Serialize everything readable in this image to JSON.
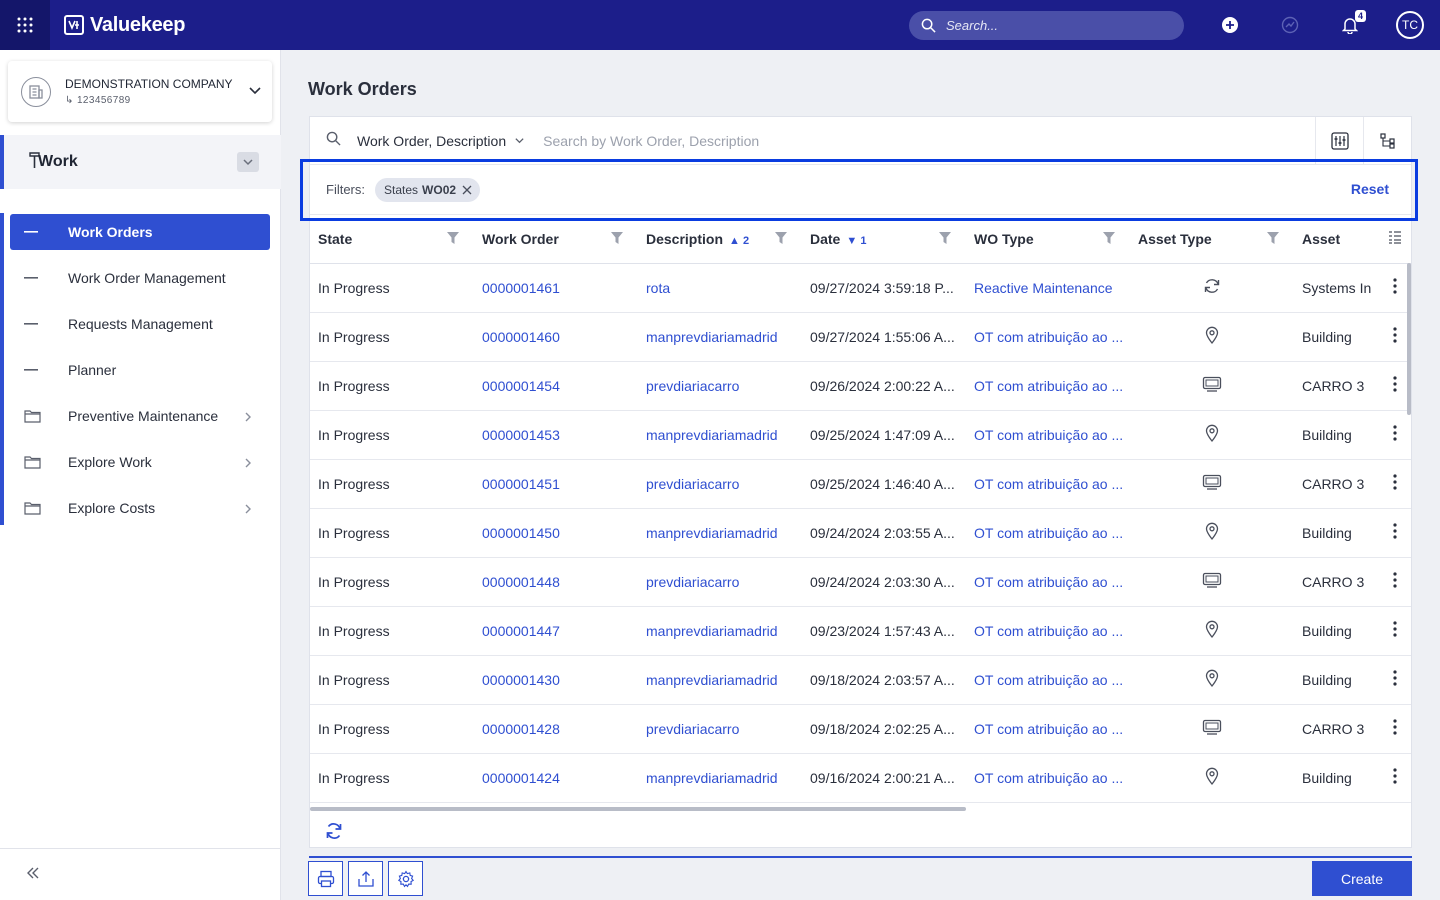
{
  "app": {
    "brand": "Valuekeep",
    "search_placeholder": "Search...",
    "notifications_count": "4",
    "user_initials": "TC"
  },
  "sidebar": {
    "company_name": "DEMONSTRATION COMPANY",
    "company_id": "123456789",
    "module": "Work",
    "items": [
      {
        "label": "Work Orders",
        "icon": "dash-icon",
        "active": true
      },
      {
        "label": "Work Order Management",
        "icon": "dash-icon"
      },
      {
        "label": "Requests Management",
        "icon": "dash-icon"
      },
      {
        "label": "Planner",
        "icon": "dash-icon"
      },
      {
        "label": "Preventive Maintenance",
        "icon": "folder-icon",
        "expandable": true
      },
      {
        "label": "Explore Work",
        "icon": "folder-icon",
        "expandable": true
      },
      {
        "label": "Explore Costs",
        "icon": "folder-icon",
        "expandable": true
      }
    ]
  },
  "main": {
    "title": "Work Orders",
    "search_scope": "Work Order, Description",
    "search_placeholder": "Search by Work Order, Description",
    "filters_label": "Filters:",
    "filter_chip_key": "States",
    "filter_chip_value": "WO02",
    "reset_label": "Reset",
    "create_label": "Create",
    "columns": [
      "State",
      "Work Order",
      "Description",
      "Date",
      "WO Type",
      "Asset Type",
      "Asset"
    ],
    "sort_description": "2",
    "sort_date": "1",
    "rows": [
      {
        "state": "In Progress",
        "wo": "0000001461",
        "desc": "rota",
        "date": "09/27/2024 3:59:18 P...",
        "type": "Reactive Maintenance",
        "asset_type": "cycle-icon",
        "asset": "Systems In"
      },
      {
        "state": "In Progress",
        "wo": "0000001460",
        "desc": "manprevdiariamadrid",
        "date": "09/27/2024 1:55:06 A...",
        "type": "OT com atribuição ao ...",
        "asset_type": "location-icon",
        "asset": "Building"
      },
      {
        "state": "In Progress",
        "wo": "0000001454",
        "desc": "prevdiariacarro",
        "date": "09/26/2024 2:00:22 A...",
        "type": "OT com atribuição ao ...",
        "asset_type": "equipment-icon",
        "asset": "CARRO 3"
      },
      {
        "state": "In Progress",
        "wo": "0000001453",
        "desc": "manprevdiariamadrid",
        "date": "09/25/2024 1:47:09 A...",
        "type": "OT com atribuição ao ...",
        "asset_type": "location-icon",
        "asset": "Building"
      },
      {
        "state": "In Progress",
        "wo": "0000001451",
        "desc": "prevdiariacarro",
        "date": "09/25/2024 1:46:40 A...",
        "type": "OT com atribuição ao ...",
        "asset_type": "equipment-icon",
        "asset": "CARRO 3"
      },
      {
        "state": "In Progress",
        "wo": "0000001450",
        "desc": "manprevdiariamadrid",
        "date": "09/24/2024 2:03:55 A...",
        "type": "OT com atribuição ao ...",
        "asset_type": "location-icon",
        "asset": "Building"
      },
      {
        "state": "In Progress",
        "wo": "0000001448",
        "desc": "prevdiariacarro",
        "date": "09/24/2024 2:03:30 A...",
        "type": "OT com atribuição ao ...",
        "asset_type": "equipment-icon",
        "asset": "CARRO 3"
      },
      {
        "state": "In Progress",
        "wo": "0000001447",
        "desc": "manprevdiariamadrid",
        "date": "09/23/2024 1:57:43 A...",
        "type": "OT com atribuição ao ...",
        "asset_type": "location-icon",
        "asset": "Building"
      },
      {
        "state": "In Progress",
        "wo": "0000001430",
        "desc": "manprevdiariamadrid",
        "date": "09/18/2024 2:03:57 A...",
        "type": "OT com atribuição ao ...",
        "asset_type": "location-icon",
        "asset": "Building"
      },
      {
        "state": "In Progress",
        "wo": "0000001428",
        "desc": "prevdiariacarro",
        "date": "09/18/2024 2:02:25 A...",
        "type": "OT com atribuição ao ...",
        "asset_type": "equipment-icon",
        "asset": "CARRO 3"
      },
      {
        "state": "In Progress",
        "wo": "0000001424",
        "desc": "manprevdiariamadrid",
        "date": "09/16/2024 2:00:21 A...",
        "type": "OT com atribuição ao ...",
        "asset_type": "location-icon",
        "asset": "Building"
      }
    ]
  },
  "colors": {
    "topbar": "#1c1e8a",
    "accent": "#2f4fd1",
    "highlight": "#0a3ce0"
  }
}
